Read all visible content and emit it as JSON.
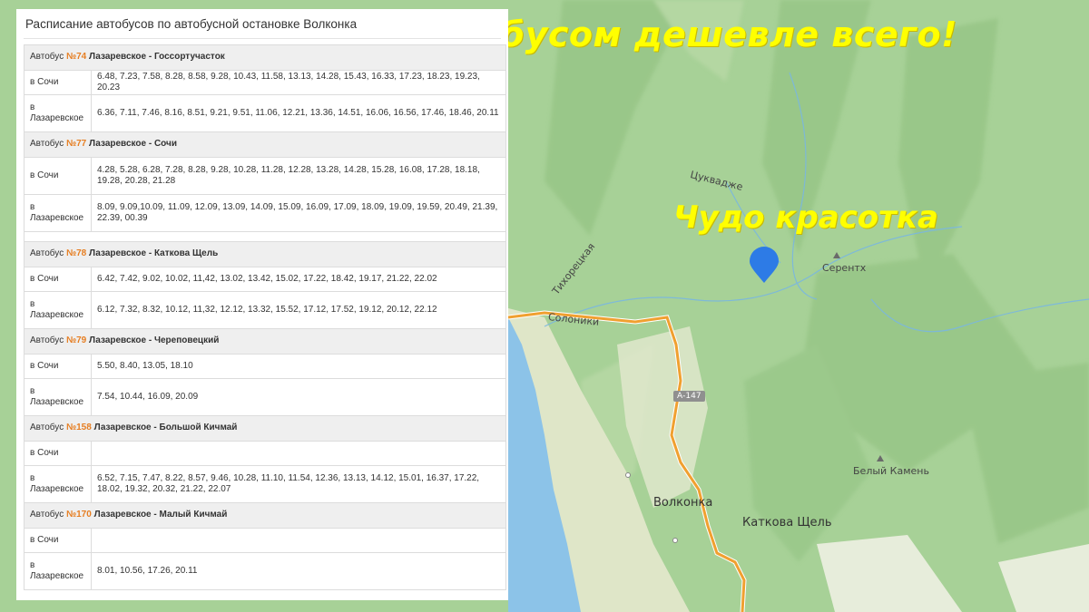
{
  "panel": {
    "title": "Расписание автобусов по автобусной остановке Волконка"
  },
  "routes": [
    {
      "prefix": "Автобус ",
      "number": "№74",
      "name": "Лазаревское - Госсортучасток",
      "rows": [
        {
          "direction": "в Сочи",
          "times": "6.48, 7.23, 7.58, 8.28, 8.58, 9.28, 10.43, 11.58, 13.13, 14.28, 15.43, 16.33, 17.23, 18.23, 19.23, 20.23"
        },
        {
          "direction": "в Лазаревское",
          "times": "6.36, 7.11, 7.46, 8.16, 8.51, 9.21, 9.51, 11.06, 12.21, 13.36, 14.51, 16.06, 16.56, 17.46, 18.46, 20.11"
        }
      ]
    },
    {
      "prefix": "Автобус ",
      "number": "№77",
      "name": "Лазаревское - Сочи",
      "rows": [
        {
          "direction": "в Сочи",
          "times": "4.28, 5.28, 6.28, 7.28, 8.28, 9.28, 10.28, 11.28, 12.28, 13.28, 14.28, 15.28, 16.08, 17.28, 18.18, 19.28, 20.28, 21.28"
        },
        {
          "direction": "в Лазаревское",
          "times": "8.09, 9.09,10.09, 11.09, 12.09, 13.09, 14.09, 15.09, 16.09, 17.09, 18.09, 19.09, 19.59, 20.49, 21.39, 22.39, 00.39"
        }
      ]
    },
    {
      "prefix": "Автобус ",
      "number": "№78",
      "name": "Лазаревское - Каткова Щель",
      "rows": [
        {
          "direction": "в Сочи",
          "times": "6.42, 7.42, 9.02, 10.02, 11,42, 13.02, 13.42, 15.02, 17.22, 18.42, 19.17, 21.22, 22.02"
        },
        {
          "direction": "в Лазаревское",
          "times": "6.12, 7.32, 8.32, 10.12, 11,32, 12.12, 13.32, 15.52, 17.12, 17.52, 19.12, 20.12, 22.12"
        }
      ]
    },
    {
      "prefix": "Автобус ",
      "number": "№79",
      "name": "Лазаревское - Череповецкий",
      "rows": [
        {
          "direction": "в Сочи",
          "times": "5.50, 8.40, 13.05, 18.10"
        },
        {
          "direction": "в Лазаревское",
          "times": "7.54, 10.44, 16.09, 20.09"
        }
      ]
    },
    {
      "prefix": "Автобус ",
      "number": "№158",
      "name": "Лазаревское - Большой Кичмай",
      "rows": [
        {
          "direction": "в Сочи",
          "times": ""
        },
        {
          "direction": "в Лазаревское",
          "times": "6.52, 7.15, 7.47, 8.22, 8.57, 9.46, 10.28, 11.10, 11.54, 12.36, 13.13, 14.12, 15.01, 16.37, 17.22, 18.02, 19.32, 20.32, 21.22, 22.07"
        }
      ]
    },
    {
      "prefix": "Автобус ",
      "number": "№170",
      "name": "Лазаревское - Малый Кичмай",
      "rows": [
        {
          "direction": "в Сочи",
          "times": ""
        },
        {
          "direction": "в Лазаревское",
          "times": "8.01, 10.56, 17.26, 20.11"
        }
      ]
    }
  ],
  "overlay": {
    "headline": "Автобусом дешевле всего!",
    "caption": "Чудо красотка"
  },
  "map": {
    "labels": {
      "volkonka": "Волконка",
      "katkova": "Каткова Щель",
      "serentkh": "Серентх",
      "bely_kamen": "Белый Камень",
      "solonitsy": "Солоники",
      "tsukvadzhe": "Цукваджe",
      "tikhorechka": "Тихорецкая",
      "road_number": "А-147"
    },
    "colors": {
      "sea": "#8cc3e8",
      "land": "#a9d39a",
      "coast": "#e8e6d6",
      "road": "#f0a030",
      "marker": "#2d7be6"
    }
  }
}
